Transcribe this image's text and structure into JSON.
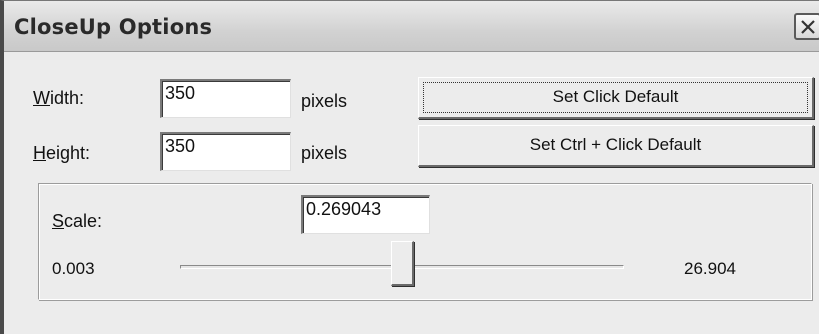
{
  "window": {
    "title": "CloseUp Options"
  },
  "width": {
    "label_mnemonic": "W",
    "label_rest": "idth:",
    "value": "350",
    "unit": "pixels"
  },
  "height": {
    "label_mnemonic": "H",
    "label_rest": "eight:",
    "value": "350",
    "unit": "pixels"
  },
  "buttons": {
    "set_click_default": "Set Click Default",
    "set_ctrl_click_default": "Set Ctrl + Click Default"
  },
  "scale": {
    "label_mnemonic": "S",
    "label_rest": "cale:",
    "value": "0.269043",
    "min_label": "0.003",
    "max_label": "26.904"
  },
  "icons": {
    "close": "close-icon"
  }
}
